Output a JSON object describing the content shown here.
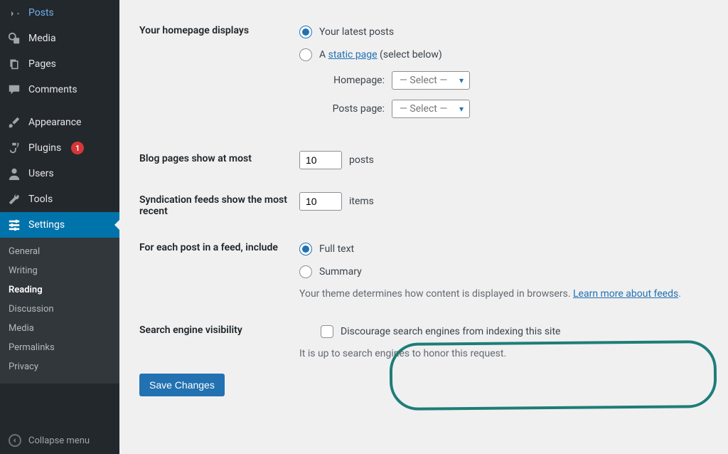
{
  "sidebar": {
    "items": [
      {
        "icon": "pin",
        "label": "Posts"
      },
      {
        "icon": "media",
        "label": "Media"
      },
      {
        "icon": "page",
        "label": "Pages"
      },
      {
        "icon": "comment",
        "label": "Comments"
      }
    ],
    "items2": [
      {
        "icon": "brush",
        "label": "Appearance"
      },
      {
        "icon": "plug",
        "label": "Plugins",
        "badge": "1"
      },
      {
        "icon": "user",
        "label": "Users"
      },
      {
        "icon": "wrench",
        "label": "Tools"
      },
      {
        "icon": "sliders",
        "label": "Settings",
        "active": true
      }
    ],
    "submenu": [
      "General",
      "Writing",
      "Reading",
      "Discussion",
      "Media",
      "Permalinks",
      "Privacy"
    ],
    "submenu_current": "Reading",
    "collapse": "Collapse menu"
  },
  "settings": {
    "homepage_displays": {
      "label": "Your homepage displays",
      "opt_latest": "Your latest posts",
      "opt_static_prefix": "A ",
      "opt_static_link": "static page",
      "opt_static_suffix": " (select below)",
      "homepage_label": "Homepage:",
      "posts_page_label": "Posts page:",
      "select_placeholder": "— Select —"
    },
    "blog_pages": {
      "label": "Blog pages show at most",
      "value": "10",
      "unit": "posts"
    },
    "syndication": {
      "label": "Syndication feeds show the most recent",
      "value": "10",
      "unit": "items"
    },
    "feed_include": {
      "label": "For each post in a feed, include",
      "opt_full": "Full text",
      "opt_summary": "Summary",
      "desc_prefix": "Your theme determines how content is displayed in browsers. ",
      "desc_link": "Learn more about feeds",
      "desc_suffix": "."
    },
    "search_visibility": {
      "label": "Search engine visibility",
      "checkbox_label": "Discourage search engines from indexing this site",
      "desc": "It is up to search engines to honor this request."
    },
    "save_button": "Save Changes"
  }
}
